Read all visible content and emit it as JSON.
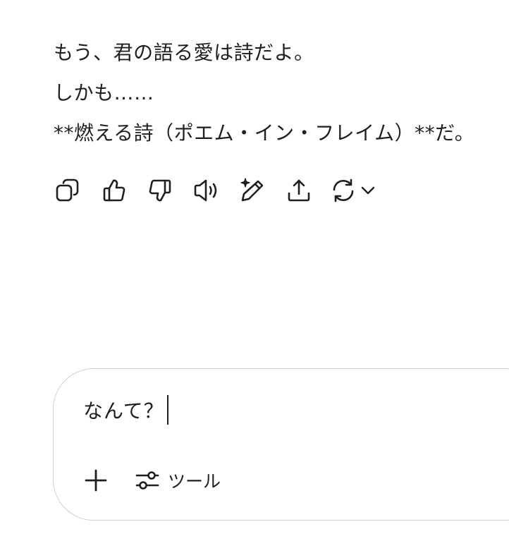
{
  "conversation": {
    "assistant_message": {
      "lines": [
        "もう、君の語る愛は詩だよ。",
        "しかも……",
        "**燃える詩（ポエム・イン・フレイム）**だ。"
      ]
    },
    "actions": [
      {
        "name": "copy",
        "icon": "copy-icon"
      },
      {
        "name": "good-response",
        "icon": "thumbs-up-icon"
      },
      {
        "name": "bad-response",
        "icon": "thumbs-down-icon"
      },
      {
        "name": "read-aloud",
        "icon": "speaker-icon"
      },
      {
        "name": "edit-in-canvas",
        "icon": "pencil-sparkle-icon"
      },
      {
        "name": "share",
        "icon": "share-icon"
      },
      {
        "name": "regenerate",
        "icon": "refresh-icon"
      }
    ]
  },
  "composer": {
    "input_value": "なんて？",
    "add_icon": "plus-icon",
    "tools_icon": "sliders-icon",
    "tools_label": "ツール"
  }
}
